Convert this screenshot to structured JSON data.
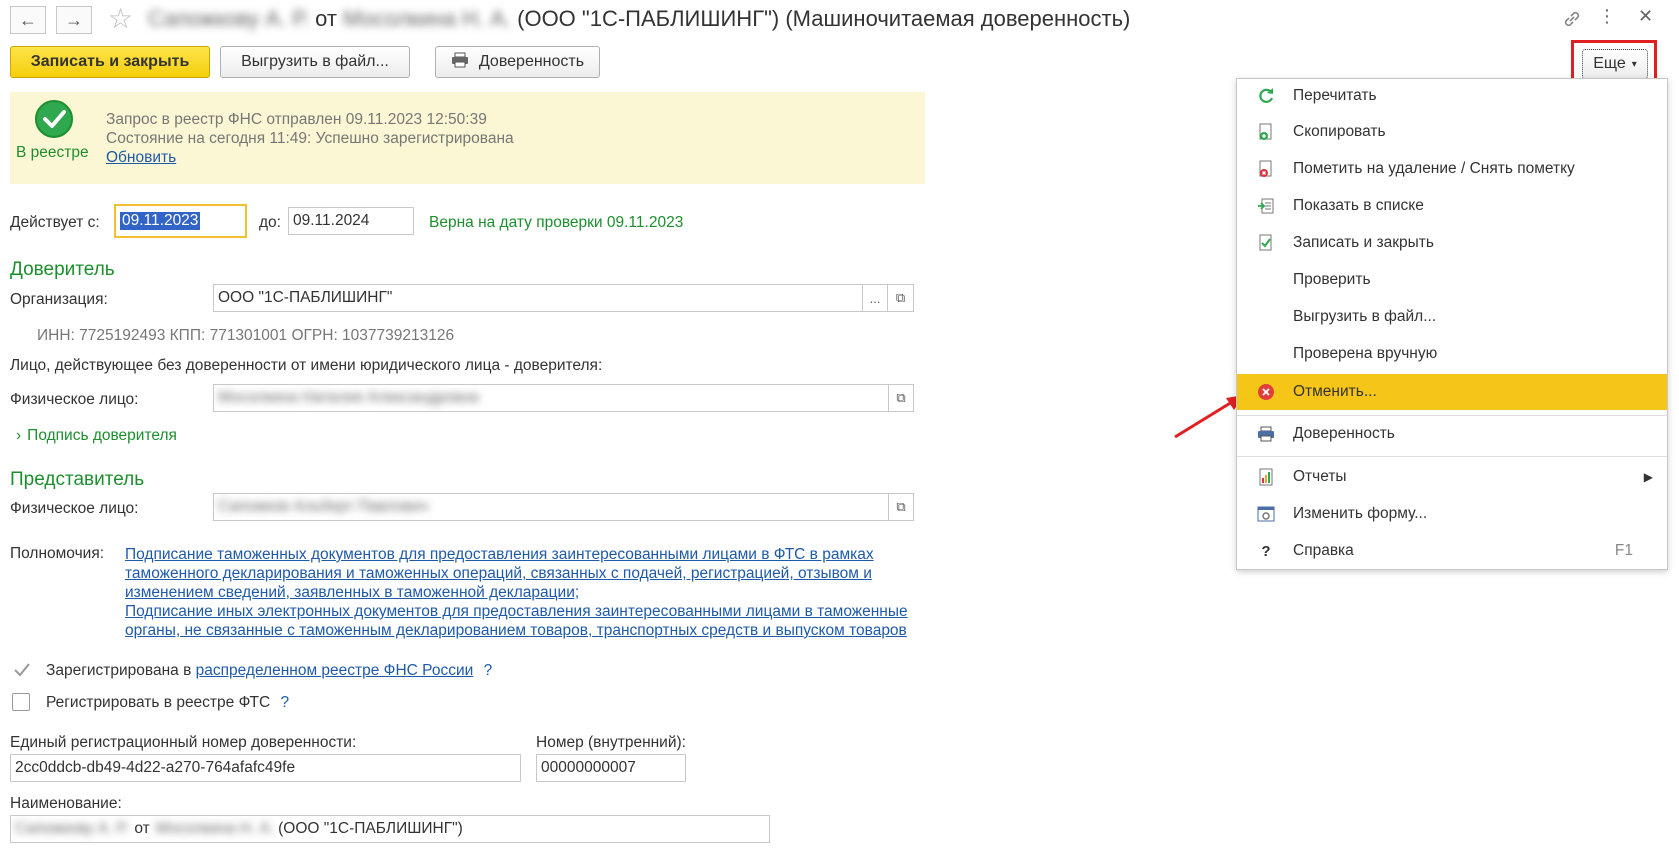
{
  "window": {
    "title_name1": "Сапожкову А. Р.",
    "title_of": "от",
    "title_name2": "Мосолкина Н. А.",
    "title_rest": "(ООО \"1С-ПАБЛИШИНГ\") (Машиночитаемая доверенность)"
  },
  "toolbar": {
    "save_close": "Записать и закрыть",
    "export": "Выгрузить в файл...",
    "print": "Доверенность",
    "more": "Еще"
  },
  "status": {
    "badge": "В реестре",
    "line1": "Запрос в реестр ФНС отправлен 09.11.2023 12:50:39",
    "line2": "Состояние на сегодня 11:49: Успешно зарегистрирована",
    "refresh": "Обновить"
  },
  "validity": {
    "from_label": "Действует с:",
    "from_value": "09.11.2023",
    "to_label": "до:",
    "to_value": "09.11.2024",
    "check": "Верна на дату проверки 09.11.2023"
  },
  "principal": {
    "section": "Доверитель",
    "org_label": "Организация:",
    "org_value": "ООО \"1С-ПАБЛИШИНГ\"",
    "org_ids": "ИНН: 7725192493 КПП: 771301001 ОГРН: 1037739213126",
    "person_title": "Лицо, действующее без доверенности от имени юридического лица - доверителя:",
    "person_label": "Физическое лицо:",
    "person_value": "Мосолкина Наталия Александровна",
    "signature": "Подпись доверителя"
  },
  "representative": {
    "section": "Представитель",
    "person_label": "Физическое лицо:",
    "person_value": "Сапожков Альберт Павлович"
  },
  "powers": {
    "label": "Полномочия:",
    "l1": "Подписание таможенных документов для предоставления заинтересованными лицами в ФТС в рамках",
    "l2": "таможенного декларирования и таможенных операций, связанных с подачей, регистрацией, отзывом и",
    "l3": "изменением сведений, заявленных в таможенной декларации;",
    "l4": "Подписание иных электронных документов для предоставления заинтересованными лицами в таможенные",
    "l5": "органы, не связанные с таможенным декларированием товаров, транспортных средств и выпуском товаров"
  },
  "registry": {
    "fns_label": "Зарегистрирована в",
    "fns_link": "распределенном реестре ФНС России",
    "fts_label": "Регистрировать в реестре ФТС",
    "help": "?"
  },
  "numbers": {
    "ern_label": "Единый регистрационный номер доверенности:",
    "ern_value": "2cc0ddcb-db49-4d22-a270-764afafc49fe",
    "internal_label": "Номер (внутренний):",
    "internal_value": "00000000007"
  },
  "name": {
    "label": "Наименование:",
    "part1": "Сапожкову А. Р.",
    "part2": "от",
    "part3": "Мосолкина Н. А.",
    "part4": "(ООО \"1С-ПАБЛИШИНГ\")"
  },
  "menu": {
    "reread": "Перечитать",
    "copy": "Скопировать",
    "mark_delete": "Пометить на удаление / Снять пометку",
    "show_list": "Показать в списке",
    "save_close": "Записать и закрыть",
    "check": "Проверить",
    "export": "Выгрузить в файл...",
    "manual": "Проверена вручную",
    "cancel": "Отменить...",
    "print": "Доверенность",
    "reports": "Отчеты",
    "change_form": "Изменить форму...",
    "help": "Справка",
    "help_key": "F1"
  },
  "colors": {
    "accent_yellow": "#f5c518",
    "green": "#1d8f2e",
    "link": "#1f5aa9",
    "annotation_red": "#e02020"
  }
}
